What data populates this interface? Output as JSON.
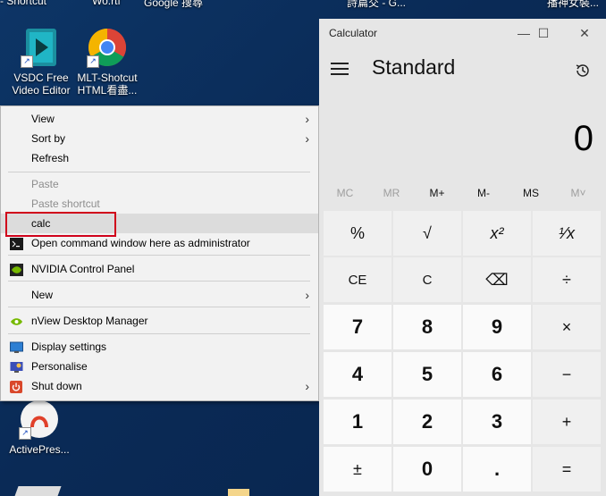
{
  "desktop": {
    "top_labels": [
      "- Shortcut",
      "Wo.rtf",
      "Google 搜尋",
      "詩篇交 - G...",
      "播神女裝..."
    ],
    "icons": [
      {
        "name": "vsdc-icon",
        "label1": "VSDC Free",
        "label2": "Video Editor"
      },
      {
        "name": "chrome-icon",
        "label1": "MLT-Shotcut",
        "label2": "HTML看盡..."
      },
      {
        "name": "activepresenter-icon",
        "label1": "ActivePres...",
        "label2": ""
      }
    ]
  },
  "context_menu": {
    "items": [
      {
        "label": "View",
        "submenu": true,
        "disabled": false
      },
      {
        "label": "Sort by",
        "submenu": true,
        "disabled": false
      },
      {
        "label": "Refresh",
        "submenu": false,
        "disabled": false
      },
      {
        "label": "Paste",
        "submenu": false,
        "disabled": true
      },
      {
        "label": "Paste shortcut",
        "submenu": false,
        "disabled": true
      },
      {
        "label": "calc",
        "submenu": false,
        "disabled": false,
        "highlighted": true
      },
      {
        "label": "Open command window here as administrator",
        "submenu": false,
        "disabled": false,
        "icon": "cmd-icon"
      },
      {
        "label": "NVIDIA Control Panel",
        "submenu": false,
        "disabled": false,
        "icon": "nvidia-icon"
      },
      {
        "label": "New",
        "submenu": true,
        "disabled": false
      },
      {
        "label": "nView Desktop Manager",
        "submenu": false,
        "disabled": false,
        "icon": "nview-icon"
      },
      {
        "label": "Display settings",
        "submenu": false,
        "disabled": false,
        "icon": "display-icon"
      },
      {
        "label": "Personalise",
        "submenu": false,
        "disabled": false,
        "icon": "personalise-icon"
      },
      {
        "label": "Shut down",
        "submenu": true,
        "disabled": false,
        "icon": "shutdown-icon"
      }
    ],
    "highlight_color": "#d0021b"
  },
  "calculator": {
    "title": "Calculator",
    "mode": "Standard",
    "display": "0",
    "window_buttons": {
      "minimize": "—",
      "maximize": "☐",
      "close": "✕"
    },
    "memory": [
      {
        "label": "MC",
        "enabled": false
      },
      {
        "label": "MR",
        "enabled": false
      },
      {
        "label": "M+",
        "enabled": true
      },
      {
        "label": "M-",
        "enabled": true
      },
      {
        "label": "MS",
        "enabled": true
      },
      {
        "label": "M˅",
        "enabled": false
      }
    ],
    "keys": [
      [
        "%",
        "√",
        "x²",
        "¹⁄x"
      ],
      [
        "CE",
        "C",
        "⌫",
        "÷"
      ],
      [
        "7",
        "8",
        "9",
        "×"
      ],
      [
        "4",
        "5",
        "6",
        "−"
      ],
      [
        "1",
        "2",
        "3",
        "+"
      ],
      [
        "±",
        "0",
        ".",
        "="
      ]
    ]
  }
}
